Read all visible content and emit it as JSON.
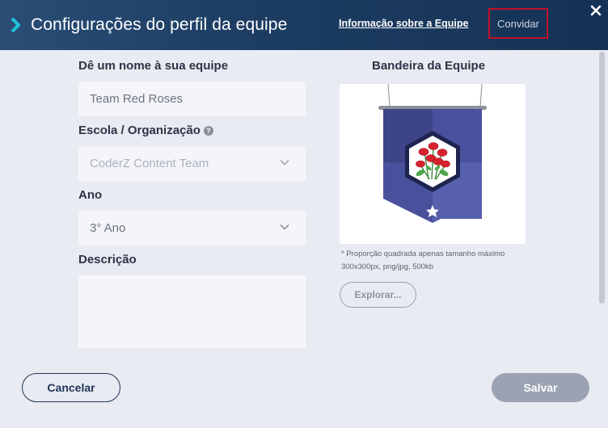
{
  "header": {
    "title": "Configurações do perfil da equipe",
    "info_link": "Informação sobre a Equipe",
    "invite_label": "Convidar",
    "close_icon": "close-icon",
    "chevron_icon": "chevron-right-icon"
  },
  "form": {
    "team_name": {
      "label": "Dê um nome à sua equipe",
      "value": "Team Red Roses"
    },
    "school": {
      "label": "Escola / Organização",
      "value": "CoderZ Content Team",
      "help_glyph": "?"
    },
    "year": {
      "label": "Ano",
      "value": "3° Ano"
    },
    "description": {
      "label": "Descrição",
      "value": ""
    }
  },
  "flag": {
    "title": "Bandeira da Equipe",
    "note": "* Proporção quadrada apenas tamanho máximo 300x300px, png/jpg, 500kb",
    "explore_label": "Explorar..."
  },
  "footer": {
    "cancel_label": "Cancelar",
    "save_label": "Salvar"
  },
  "colors": {
    "header": "#1d3d63",
    "accent": "#1cc5d8",
    "invite_border": "#c0112a",
    "save_disabled": "#9ba3b3",
    "flag_banner": "#4a519c"
  }
}
